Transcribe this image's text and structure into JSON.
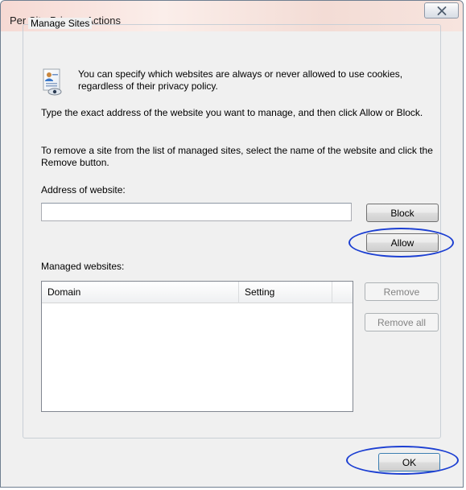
{
  "window": {
    "title": "Per Site Privacy Actions"
  },
  "manage_sites": {
    "group_label": "Manage Sites",
    "intro_text": "You can specify which websites are always or never allowed to use cookies, regardless of their privacy policy.",
    "instruction_1": "Type the exact address of the website you want to manage, and then click Allow or Block.",
    "instruction_2": "To remove a site from the list of managed sites, select the name of the website and click the Remove button.",
    "address_label": "Address of website:",
    "address_value": "",
    "block_label": "Block",
    "allow_label": "Allow",
    "managed_label": "Managed websites:",
    "columns": [
      "Domain",
      "Setting"
    ],
    "rows": [],
    "remove_label": "Remove",
    "remove_all_label": "Remove all"
  },
  "footer": {
    "ok_label": "OK"
  },
  "colors": {
    "highlight_ring": "#1c3fd2"
  }
}
